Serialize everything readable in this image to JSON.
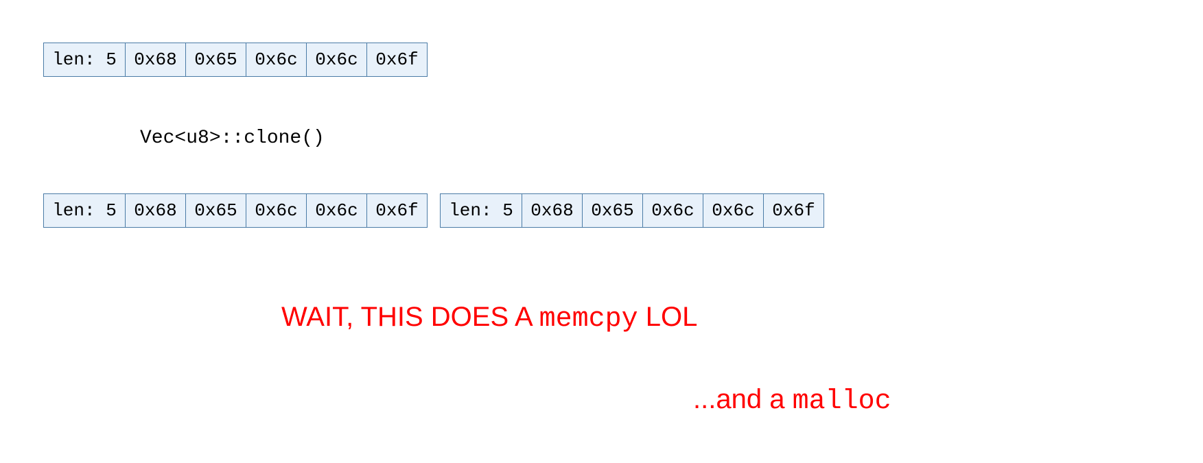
{
  "rows": {
    "top": {
      "len": "len: 5",
      "b0": "0x68",
      "b1": "0x65",
      "b2": "0x6c",
      "b3": "0x6c",
      "b4": "0x6f"
    },
    "left": {
      "len": "len: 5",
      "b0": "0x68",
      "b1": "0x65",
      "b2": "0x6c",
      "b3": "0x6c",
      "b4": "0x6f"
    },
    "right": {
      "len": "len: 5",
      "b0": "0x68",
      "b1": "0x65",
      "b2": "0x6c",
      "b3": "0x6c",
      "b4": "0x6f"
    }
  },
  "clone_label": "Vec<u8>::clone()",
  "caption": {
    "main_pre": "WAIT, THIS DOES A ",
    "main_mono": "memcpy",
    "main_post": " LOL",
    "sub_pre": "...and a ",
    "sub_mono": "malloc"
  }
}
